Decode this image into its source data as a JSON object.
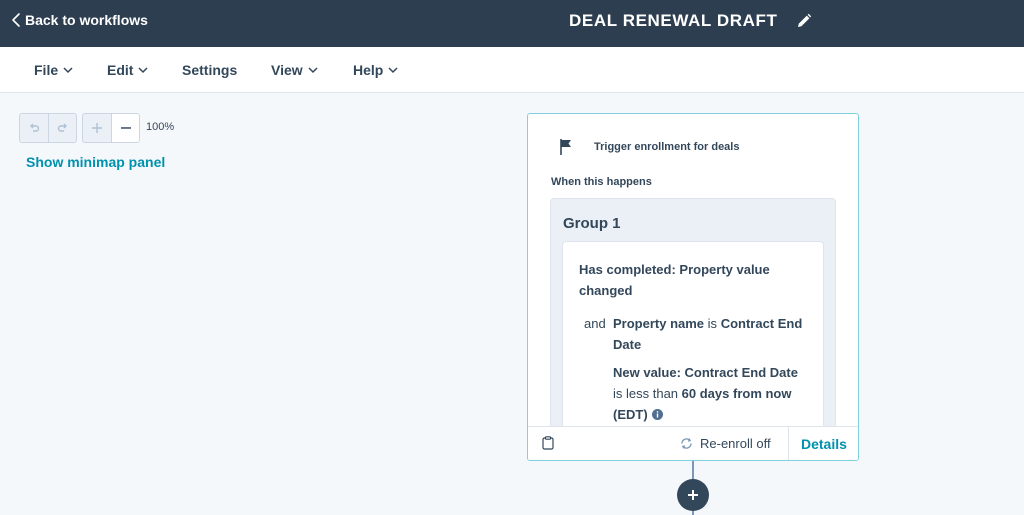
{
  "header": {
    "back_label": "Back to workflows",
    "workflow_title": "DEAL RENEWAL DRAFT",
    "back_icon": "chevron-left-icon",
    "edit_icon": "pencil-icon"
  },
  "menu": {
    "items": [
      {
        "label": "File",
        "has_caret": true
      },
      {
        "label": "Edit",
        "has_caret": true
      },
      {
        "label": "Settings",
        "has_caret": false
      },
      {
        "label": "View",
        "has_caret": true
      },
      {
        "label": "Help",
        "has_caret": true
      }
    ]
  },
  "canvas_controls": {
    "undo_icon": "undo-icon",
    "redo_icon": "redo-icon",
    "zoom_in_icon": "plus-icon",
    "zoom_out_icon": "minus-icon",
    "zoom_level": "100%",
    "minimap_link": "Show minimap panel"
  },
  "trigger": {
    "icon": "flag-icon",
    "title": "Trigger enrollment for deals",
    "when_label": "When this happens",
    "group": {
      "title": "Group 1",
      "criteria_title": "Has completed: Property value changed",
      "and_label": "and",
      "condition1": {
        "property_label": "Property name",
        "operator": "is",
        "value": "Contract End Date"
      },
      "condition2": {
        "property_label": "New value: Contract End Date",
        "operator": "is less than",
        "value": "60 days from now (EDT)",
        "info_icon": "info-icon"
      }
    },
    "footer": {
      "clipboard_icon": "clipboard-icon",
      "reenroll_icon": "refresh-icon",
      "reenroll_label": "Re-enroll off",
      "details_label": "Details"
    }
  },
  "add_step_icon": "plus-icon",
  "colors": {
    "topbar": "#2d3e50",
    "accent": "#0091ae",
    "text": "#33475b",
    "canvas": "#f5f8fa",
    "card_border": "#7fd1de"
  }
}
